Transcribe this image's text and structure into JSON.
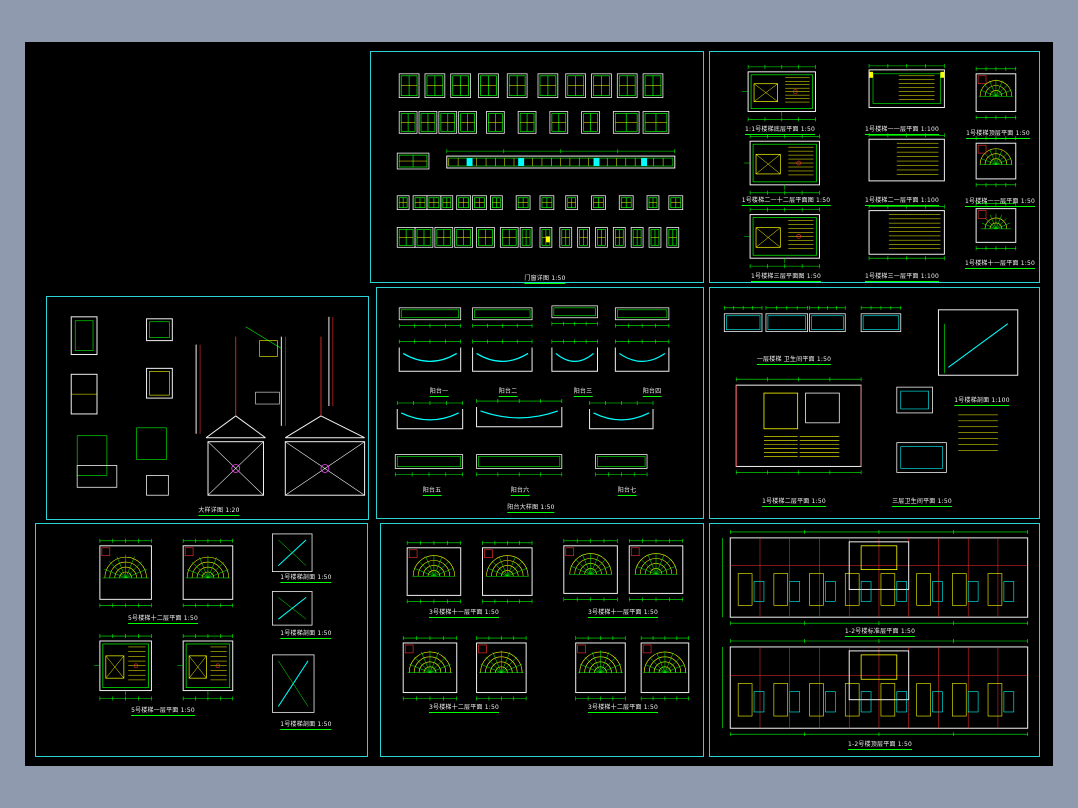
{
  "colors": {
    "frame_bg": "#8f9aae",
    "sheet": "#000000",
    "border": "#2ad4d4",
    "line_green": "#00ff00",
    "line_yellow": "#ffff00",
    "line_cyan": "#00ffff",
    "line_red": "#ff3030",
    "line_white": "#f2f2f2",
    "line_magenta": "#ff40ff"
  },
  "panels": {
    "doors_windows": {
      "title": "门窗详图 1:50"
    },
    "stair_1": {
      "t1": "1:1号楼梯底层平面 1:50",
      "t2": "1号楼梯二一十二层平面图 1:50",
      "t3": "1号楼梯三层平面图 1:50",
      "t4": "1号楼梯一一层平面 1:100",
      "t5": "1号楼梯二一层平面 1:100",
      "t6": "1号楼梯三一层平面 1:100",
      "t7": "1号楼梯顶层平面 1:50",
      "t8": "1号楼梯一一层平面 1:50",
      "t9": "1号楼梯十一层平面 1:50"
    },
    "nodes": {
      "title": "大样详图 1:20"
    },
    "balcony": {
      "a1": "阳台一",
      "a2": "阳台二",
      "a3": "阳台三",
      "a4": "阳台四",
      "a5": "阳台五",
      "a6": "阳台六",
      "a7": "阳台七",
      "main": "阳台大样图 1:50"
    },
    "elevator": {
      "t1": "一层楼梯 卫生间平面 1:50",
      "t2": "1号楼梯剖面 1:100",
      "t3": "1号楼梯二层平面 1:50",
      "t4": "三层卫生间平面 1:50"
    },
    "stair_5": {
      "t1": "5号楼梯十二层平面 1:50",
      "t2": "5号楼梯一层平面 1:50",
      "s1": "1号楼梯剖面 1:50",
      "s2": "1号楼梯剖面 1:50",
      "s3": "1号楼梯剖面 1:50"
    },
    "stair_3": {
      "t1": "3号楼梯十一层平面 1:50",
      "t2": "3号楼梯十一层平面 1:50",
      "t3": "3号楼梯十二层平面 1:50",
      "t4": "3号楼梯十二层平面 1:50"
    },
    "plans": {
      "t1": "1-2号楼标准层平面 1:50",
      "t2": "1-2号楼顶层平面 1:50"
    }
  }
}
